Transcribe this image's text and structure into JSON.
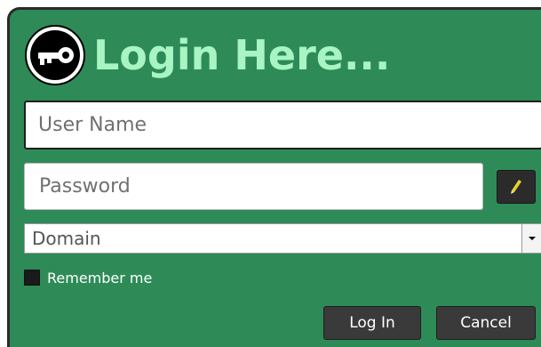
{
  "header": {
    "title": "Login Here...",
    "icon": "key-icon"
  },
  "form": {
    "username_placeholder": "User Name",
    "password_placeholder": "Password",
    "edit_icon": "pencil-icon",
    "domain": {
      "selected": "Domain"
    },
    "remember_label": "Remember me",
    "remember_checked": false
  },
  "actions": {
    "login_label": "Log In",
    "cancel_label": "Cancel"
  },
  "colors": {
    "panel_background": "#2e8b57",
    "title_text": "#a8f5c3",
    "button_background": "#3a3a3a"
  }
}
